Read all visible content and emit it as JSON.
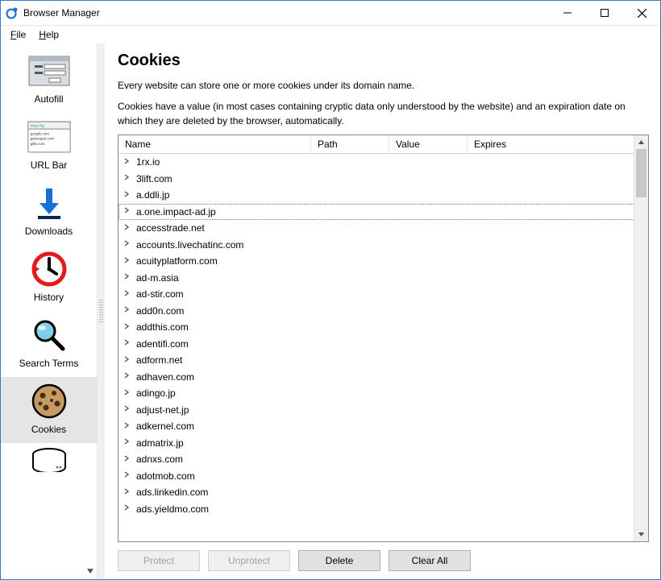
{
  "window": {
    "title": "Browser Manager"
  },
  "menu": {
    "file": "File",
    "help": "Help"
  },
  "sidebar": {
    "items": [
      {
        "label": "Autofill"
      },
      {
        "label": "URL Bar"
      },
      {
        "label": "Downloads"
      },
      {
        "label": "History"
      },
      {
        "label": "Search Terms"
      },
      {
        "label": "Cookies"
      },
      {
        "label": ""
      }
    ],
    "selected_index": 5
  },
  "page": {
    "title": "Cookies",
    "desc1": "Every website can store one or more cookies under its domain name.",
    "desc2": "Cookies have a value (in most cases containing cryptic data only understood by the website) and an expiration date on which they are deleted by the browser, automatically."
  },
  "columns": {
    "name": "Name",
    "path": "Path",
    "value": "Value",
    "expires": "Expires"
  },
  "rows": [
    "1rx.io",
    "3lift.com",
    "a.ddli.jp",
    "a.one.impact-ad.jp",
    "accesstrade.net",
    "accounts.livechatinc.com",
    "acuityplatform.com",
    "ad-m.asia",
    "ad-stir.com",
    "add0n.com",
    "addthis.com",
    "adentifi.com",
    "adform.net",
    "adhaven.com",
    "adingo.jp",
    "adjust-net.jp",
    "adkernel.com",
    "admatrix.jp",
    "adnxs.com",
    "adotmob.com",
    "ads.linkedin.com",
    "ads.yieldmo.com"
  ],
  "selected_row": 3,
  "buttons": {
    "protect": "Protect",
    "unprotect": "Unprotect",
    "delete": "Delete",
    "clear_all": "Clear All"
  }
}
